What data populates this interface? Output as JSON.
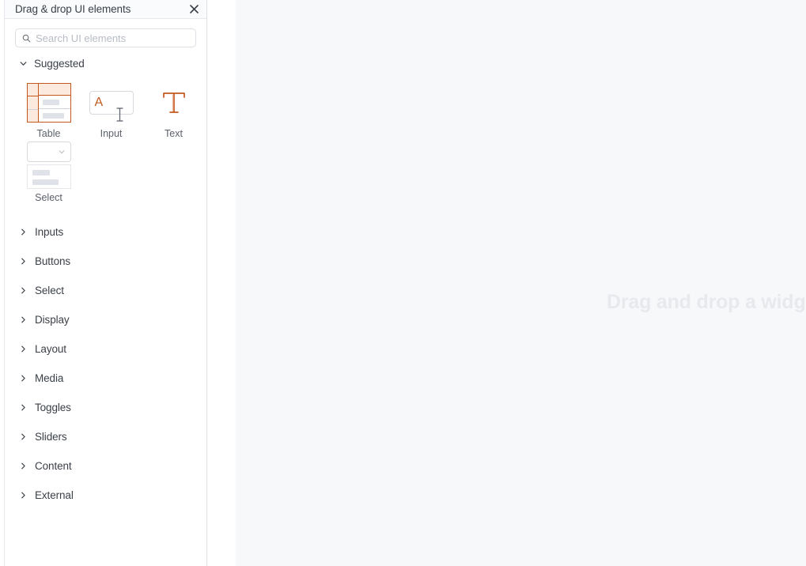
{
  "panel": {
    "title": "Drag & drop UI elements",
    "close_icon": "close-icon",
    "search": {
      "placeholder": "Search UI elements",
      "value": "",
      "icon": "search-icon"
    },
    "suggested": {
      "label": "Suggested",
      "expanded": true,
      "chevron_icon": "chevron-down-icon",
      "widgets": [
        {
          "label": "Table",
          "icon": "table-widget-icon"
        },
        {
          "label": "Input",
          "icon": "input-widget-icon"
        },
        {
          "label": "Text",
          "icon": "text-widget-icon"
        },
        {
          "label": "Select",
          "icon": "select-widget-icon"
        }
      ]
    },
    "categories": [
      {
        "label": "Inputs",
        "chevron_icon": "chevron-right-icon",
        "expanded": false
      },
      {
        "label": "Buttons",
        "chevron_icon": "chevron-right-icon",
        "expanded": false
      },
      {
        "label": "Select",
        "chevron_icon": "chevron-right-icon",
        "expanded": false
      },
      {
        "label": "Display",
        "chevron_icon": "chevron-right-icon",
        "expanded": false
      },
      {
        "label": "Layout",
        "chevron_icon": "chevron-right-icon",
        "expanded": false
      },
      {
        "label": "Media",
        "chevron_icon": "chevron-right-icon",
        "expanded": false
      },
      {
        "label": "Toggles",
        "chevron_icon": "chevron-right-icon",
        "expanded": false
      },
      {
        "label": "Sliders",
        "chevron_icon": "chevron-right-icon",
        "expanded": false
      },
      {
        "label": "Content",
        "chevron_icon": "chevron-right-icon",
        "expanded": false
      },
      {
        "label": "External",
        "chevron_icon": "chevron-right-icon",
        "expanded": false
      }
    ]
  },
  "canvas": {
    "placeholder": "Drag and drop a widget here"
  },
  "colors": {
    "accent": "#c4581f",
    "accent_fill": "#fdeade",
    "panel_border": "#e6e8eb",
    "canvas_bg": "#f7f8fa",
    "canvas_placeholder_text": "#e7e9ed",
    "text_primary": "#3b4048",
    "text_secondary": "#5b616b",
    "placeholder_text": "#b7bcc4"
  }
}
